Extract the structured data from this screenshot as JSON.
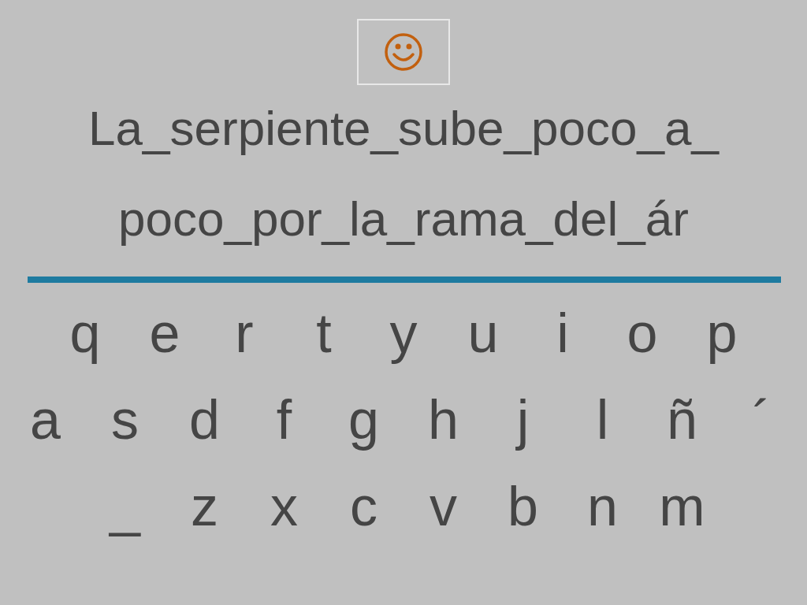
{
  "sentence_lines": [
    "La_serpiente_sube_poco_a_",
    "poco_por_la_rama_del_ár"
  ],
  "keyboard_rows": [
    [
      "q",
      "e",
      "r",
      "t",
      "y",
      "u",
      "i",
      "o",
      "p"
    ],
    [
      "a",
      "s",
      "d",
      "f",
      "g",
      "h",
      "j",
      "l",
      "ñ",
      "´"
    ],
    [
      "_",
      "z",
      "x",
      "c",
      "v",
      "b",
      "n",
      "m"
    ]
  ]
}
